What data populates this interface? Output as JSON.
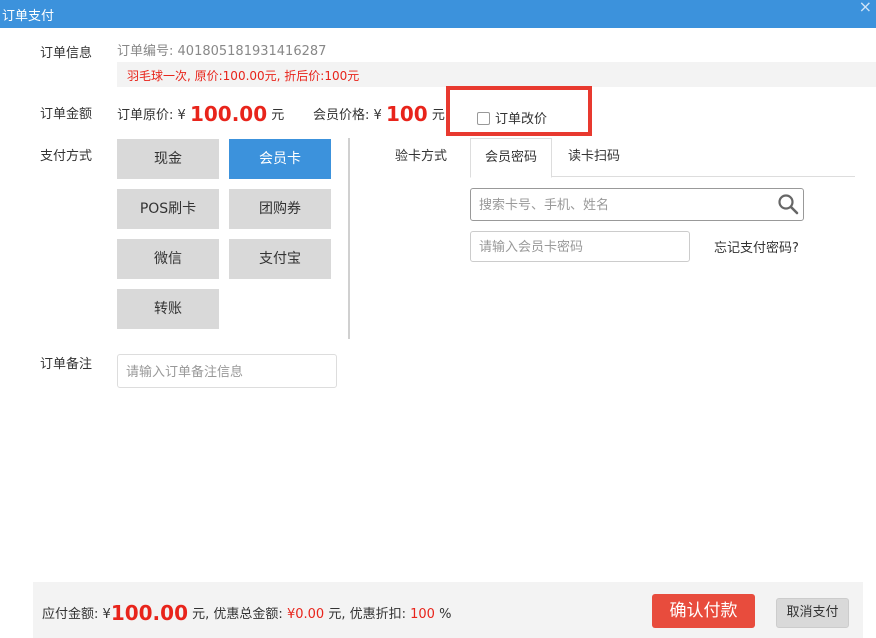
{
  "window": {
    "title": "订单支付",
    "close_glyph": "×"
  },
  "order_info": {
    "label": "订单信息",
    "order_no_label": "订单编号:",
    "order_no": "401805181931416287",
    "description": "羽毛球一次, 原价:100.00元, 折后价:100元"
  },
  "order_amount": {
    "label": "订单金额",
    "original_label": "订单原价:",
    "currency": "¥",
    "original_value": "100.00",
    "unit": "元",
    "member_label": "会员价格:",
    "member_value": "100",
    "change_price_label": "订单改价",
    "change_price_checked": false
  },
  "payment": {
    "label": "支付方式",
    "methods": [
      "现金",
      "会员卡",
      "POS刷卡",
      "团购券",
      "微信",
      "支付宝",
      "转账"
    ],
    "selected": "会员卡"
  },
  "verify": {
    "label": "验卡方式",
    "tabs": [
      "会员密码",
      "读卡扫码"
    ],
    "active_tab": "会员密码",
    "search_placeholder": "搜索卡号、手机、姓名",
    "password_placeholder": "请输入会员卡密码",
    "forgot_label": "忘记支付密码?"
  },
  "note": {
    "label": "订单备注",
    "placeholder": "请输入订单备注信息"
  },
  "footer": {
    "payable_label": "应付金额:",
    "currency": "¥",
    "payable_value": "100.00",
    "unit_sep": "元,",
    "discount_total_label": "优惠总金额:",
    "discount_total_value": "¥0.00",
    "discount_rate_label": "优惠折扣:",
    "discount_rate_value": "100",
    "percent": "%",
    "confirm_label": "确认付款",
    "cancel_label": "取消支付"
  },
  "colors": {
    "titlebar": "#3c92dc",
    "accent_blue": "#3c92dc",
    "price_red": "#e8241b",
    "confirm_red": "#e84c3d",
    "highlight_box": "#e8392f"
  }
}
